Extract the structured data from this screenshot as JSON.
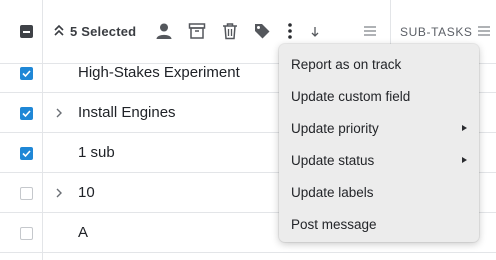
{
  "toolbar": {
    "selected_label": "5 Selected",
    "icons": [
      "collapse-icon",
      "person-icon",
      "archive-icon",
      "trash-icon",
      "tag-icon",
      "more-vertical-icon",
      "sort-down-icon",
      "column-menu-icon"
    ]
  },
  "columns": {
    "subtasks_label": "SUB-TASKS"
  },
  "rows": [
    {
      "name": "High-Stakes Experiment",
      "checked": true,
      "expandable": false
    },
    {
      "name": "Install Engines",
      "checked": true,
      "expandable": true
    },
    {
      "name": "1 sub",
      "checked": true,
      "expandable": false
    },
    {
      "name": "10",
      "checked": false,
      "expandable": true
    },
    {
      "name": "A",
      "checked": false,
      "expandable": false
    }
  ],
  "menu": {
    "items": [
      {
        "label": "Report as on track",
        "submenu": false
      },
      {
        "label": "Update custom field",
        "submenu": false
      },
      {
        "label": "Update priority",
        "submenu": true
      },
      {
        "label": "Update status",
        "submenu": true
      },
      {
        "label": "Update labels",
        "submenu": false
      },
      {
        "label": "Post message",
        "submenu": false
      }
    ]
  },
  "colors": {
    "accent": "#1f87d6",
    "menu_bg": "#ececec",
    "border": "#e3e5e8",
    "icon": "#54575c"
  }
}
